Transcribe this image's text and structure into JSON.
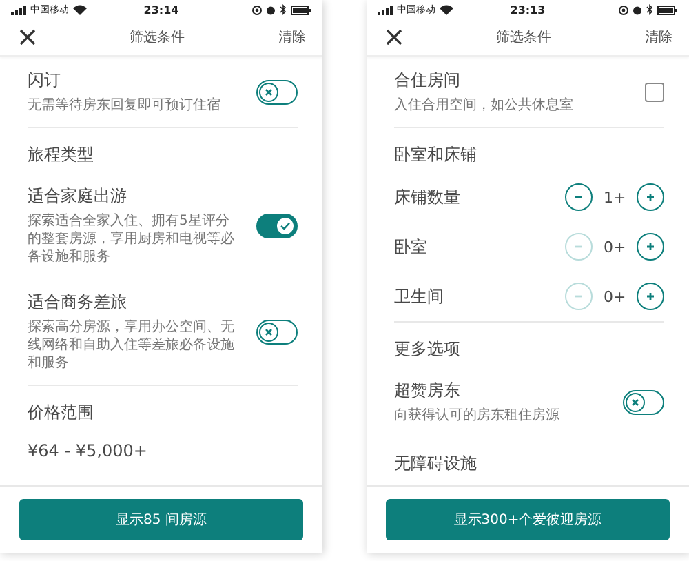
{
  "screens": [
    {
      "status_bar": {
        "carrier": "中国移动",
        "time": "23:14"
      },
      "header": {
        "title": "筛选条件",
        "action": "清除"
      },
      "items": [
        {
          "kind": "toggle",
          "title": "闪订",
          "description": "无需等待房东回复即可预订住宿",
          "on": false,
          "divider": true
        },
        {
          "kind": "heading",
          "title": "旅程类型",
          "divider": false
        },
        {
          "kind": "toggle",
          "title": "适合家庭出游",
          "description": "探索适合全家入住、拥有5星评分的整套房源，享用厨房和电视等必备设施和服务",
          "on": true,
          "divider": false
        },
        {
          "kind": "toggle",
          "title": "适合商务差旅",
          "description": "探索高分房源，享用办公空间、无线网络和自助入住等差旅必备设施和服务",
          "on": false,
          "divider": true
        },
        {
          "kind": "heading",
          "title": "价格范围",
          "divider": false
        },
        {
          "kind": "price",
          "title": "¥64 - ¥5,000+",
          "divider": false
        }
      ],
      "footer_button": "显示85 间房源"
    },
    {
      "status_bar": {
        "carrier": "中国移动",
        "time": "23:13"
      },
      "header": {
        "title": "筛选条件",
        "action": "清除"
      },
      "items": [
        {
          "kind": "checkbox",
          "title": "合住房间",
          "description": "入住合用空间，如公共休息室",
          "checked": false,
          "divider": true
        },
        {
          "kind": "heading",
          "title": "卧室和床铺",
          "divider": false
        },
        {
          "kind": "stepper",
          "title": "床铺数量",
          "value": "1+",
          "decrement_disabled": false,
          "divider": false
        },
        {
          "kind": "stepper",
          "title": "卧室",
          "value": "0+",
          "decrement_disabled": true,
          "divider": false
        },
        {
          "kind": "stepper",
          "title": "卫生间",
          "value": "0+",
          "decrement_disabled": true,
          "divider": true
        },
        {
          "kind": "heading",
          "title": "更多选项",
          "divider": false
        },
        {
          "kind": "toggle",
          "title": "超赞房东",
          "description": "向获得认可的房东租住房源",
          "on": false,
          "divider": false
        },
        {
          "kind": "heading",
          "title": "无障碍设施",
          "divider": false
        }
      ],
      "footer_button": "显示300+个爱彼迎房源"
    }
  ]
}
